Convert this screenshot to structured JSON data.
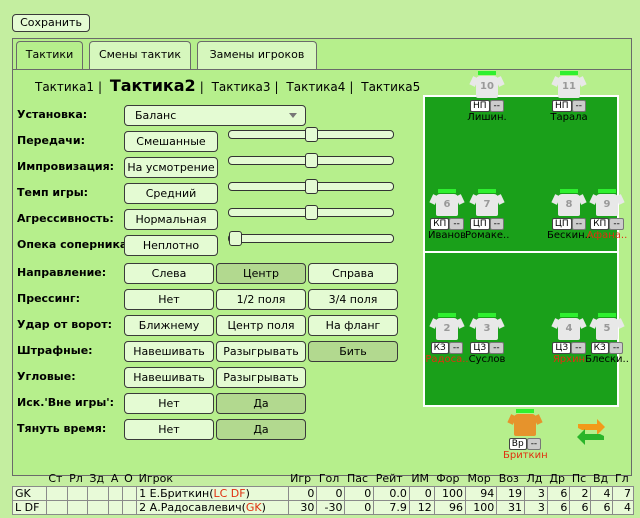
{
  "save_label": "Сохранить",
  "tabs": [
    {
      "label": "Тактики"
    },
    {
      "label": "Смены тактик"
    },
    {
      "label": "Замены игроков"
    }
  ],
  "tactics": {
    "t1": "Тактика1",
    "sep": "|",
    "t2": "Тактика2",
    "t3": "Тактика3",
    "t4": "Тактика4",
    "t5": "Тактика5"
  },
  "settings": {
    "ustanovka": {
      "label": "Установка:",
      "value": "Баланс"
    },
    "peredachi": {
      "label": "Передачи:",
      "value": "Смешанные",
      "level": 0.5
    },
    "improv": {
      "label": "Импровизация:",
      "value": "На усмотрение",
      "level": 0.5
    },
    "temp": {
      "label": "Темп игры:",
      "value": "Средний",
      "level": 0.5
    },
    "agres": {
      "label": "Агрессивность:",
      "value": "Нормальная",
      "level": 0.5
    },
    "opeka": {
      "label": "Опека соперника:",
      "value": "Неплотно",
      "level": 0.0
    }
  },
  "groups": {
    "napr": {
      "label": "Направление:",
      "options": [
        "Слева",
        "Центр",
        "Справа"
      ],
      "selected": 1
    },
    "press": {
      "label": "Прессинг:",
      "options": [
        "Нет",
        "1/2 поля",
        "3/4 поля"
      ],
      "selected": -1
    },
    "udar": {
      "label": "Удар от ворот:",
      "options": [
        "Ближнему",
        "Центр поля",
        "На фланг"
      ],
      "selected": -1
    },
    "shtraf": {
      "label": "Штрафные:",
      "options": [
        "Навешивать",
        "Разыгрывать",
        "Бить"
      ],
      "selected": 2
    },
    "uglovye": {
      "label": "Угловые:",
      "options": [
        "Навешивать",
        "Разыгрывать"
      ],
      "selected": -1
    },
    "offside": {
      "label": "Иск.'Вне игры':",
      "options": [
        "Нет",
        "Да"
      ],
      "selected": 1
    },
    "time": {
      "label": "Тянуть время:",
      "options": [
        "Нет",
        "Да"
      ],
      "selected": 1
    }
  },
  "players": [
    {
      "num": "10",
      "pos": "НП",
      "name": "Лишин.",
      "red": false
    },
    {
      "num": "11",
      "pos": "НП",
      "name": "Тарала",
      "red": false
    },
    {
      "num": "6",
      "pos": "КП",
      "name": "Иванов",
      "red": false
    },
    {
      "num": "7",
      "pos": "ЦП",
      "name": "Ромаке..",
      "red": false
    },
    {
      "num": "8",
      "pos": "ЦП",
      "name": "Бескин..",
      "red": false
    },
    {
      "num": "9",
      "pos": "КП",
      "name": "Афана..",
      "red": true
    },
    {
      "num": "2",
      "pos": "КЗ",
      "name": "Радоса..",
      "red": true
    },
    {
      "num": "3",
      "pos": "ЦЗ",
      "name": "Суслов",
      "red": false
    },
    {
      "num": "4",
      "pos": "ЦЗ",
      "name": "Ярхин",
      "red": true
    },
    {
      "num": "5",
      "pos": "КЗ",
      "name": "Блески..",
      "red": false
    },
    {
      "num": "",
      "pos": "Вр",
      "name": "Бриткин",
      "red": true
    }
  ],
  "dash": "--",
  "table": {
    "headers": [
      "Ст",
      "Рл",
      "Зд",
      "А",
      "О",
      "Игрок",
      "Игр",
      "Гол",
      "Пас",
      "Рейт",
      "ИМ",
      "Фор",
      "Мор",
      "Воз",
      "Лд",
      "Др",
      "Пс",
      "Вд",
      "Гл"
    ],
    "rows": [
      {
        "pos": "GK",
        "num": "1",
        "name": "Е.Бриткин",
        "extra": "LC DF",
        "stats": [
          "0",
          "0",
          "0",
          "0.0",
          "0",
          "100",
          "94",
          "19",
          "3",
          "6",
          "2",
          "4",
          "7"
        ]
      },
      {
        "pos": "L DF",
        "num": "2",
        "name": "А.Радосавлевич",
        "extra": "GK",
        "stats": [
          "30",
          "-30",
          "0",
          "7.9",
          "12",
          "96",
          "100",
          "31",
          "3",
          "6",
          "6",
          "6",
          "4"
        ]
      }
    ]
  }
}
